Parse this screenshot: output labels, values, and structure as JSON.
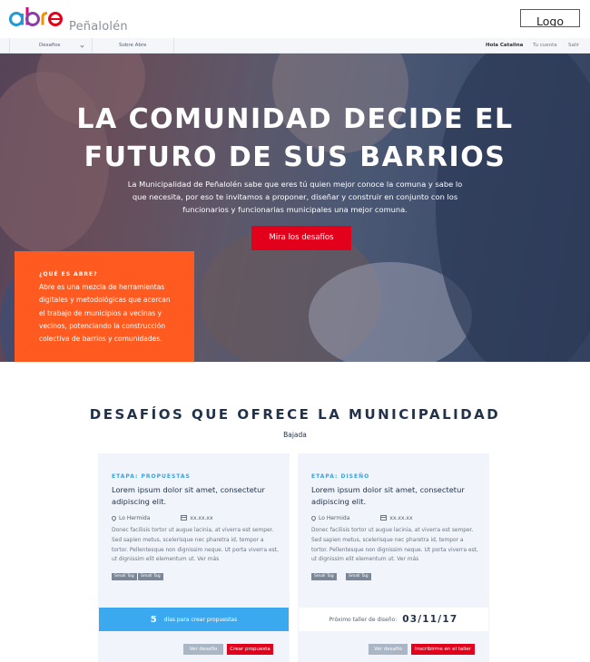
{
  "header": {
    "logo_text": "abre",
    "logo_subtitle": "Peñalolén",
    "logo_muni": "Logo Muni"
  },
  "nav": {
    "desafios": "Desafios",
    "sobre": "Sobre Abre",
    "greeting": "Hola Catalina",
    "account": "Tu cuenta",
    "logout": "Salir"
  },
  "hero": {
    "title_line1": "LA COMUNIDAD DECIDE EL",
    "title_line2": "FUTURO DE SUS BARRIOS",
    "text": "La Municipalidad de Peñalolén sabe que eres tú quien mejor conoce la comuna y sabe lo que necesita, por eso te invitamos a proponer, diseñar y construir en conjunto con los funcionarios y funcionarias municipales una mejor comuna.",
    "cta": "Mira los desafíos",
    "about_question": "¿QUÉ ES ABRE?",
    "about_text": "Abre es una mezcla de herramientas digitales y metodológicas que acercan el trabajo de municipios a vecinas y vecinos, potenciando la construcción colectiva de barrios y comunidades."
  },
  "section": {
    "title": "DESAFÍOS QUE OFRECE LA MUNICIPALIDAD",
    "subtitle": "Bajada"
  },
  "cards": [
    {
      "stage": "ETAPA: PROPUESTAS",
      "title": "Lorem ipsum dolor sit amet, consectetur adipiscing elit.",
      "location": "Lo Hermida",
      "date": "xx.xx.xx",
      "description": "Donec facilisis tortor ut augue lacinia, at viverra est semper. Sed sapien metus, scelerisque nec pharetra id, tempor a tortor. Pellentesque non dignissim neque. Ut porta viverra est, ut dignissim elit elementum ut.  Ver más",
      "tags": [
        "Small Tag",
        "Small Tag"
      ],
      "bar_number": "5",
      "bar_label": "días para crear propuestas",
      "btn_secondary": "Ver desafío",
      "btn_primary": "Crear propuesta"
    },
    {
      "stage": "ETAPA: DISEÑO",
      "title": "Lorem ipsum dolor sit amet, consectetur adipiscing elit.",
      "location": "Lo Hermida",
      "date": "xx.xx.xx",
      "description": "Donec facilisis tortor ut augue lacinia, at viverra est semper. Sed sapien metus, scelerisque nec pharetra id, tempor a tortor. Pellentesque non dignissim neque. Ut porta viverra est, ut dignissim elit elementum ut.  Ver más",
      "tags": [
        "Small Tag",
        "Small Tag"
      ],
      "bar_label": "Próximo taller de diseño:",
      "bar_date": "03/11/17",
      "btn_secondary": "Ver desafío",
      "btn_primary": "Inscribirme en el taller"
    }
  ],
  "colors": {
    "accent_red": "#e3001b",
    "accent_orange": "#ff5a1f",
    "accent_blue": "#3aa9ef",
    "text_dark": "#22324a"
  }
}
